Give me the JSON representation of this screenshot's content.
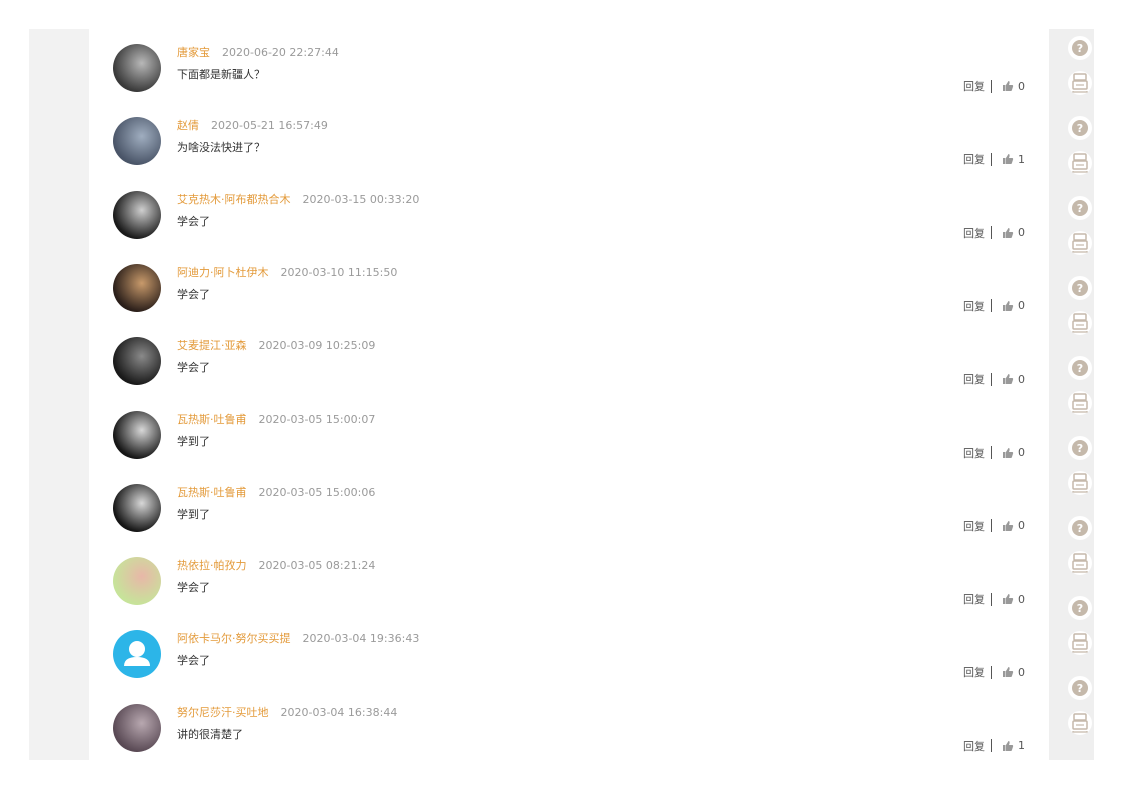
{
  "comments": [
    {
      "username": "唐家宝",
      "time": "2020-06-20 22:27:44",
      "text": "下面都是新疆人？",
      "reply": "回复",
      "likes": "0",
      "avatar_colors": [
        "#3a3a3a",
        "#b8b8b8"
      ]
    },
    {
      "username": "赵倩",
      "time": "2020-05-21 16:57:49",
      "text": "为啥没法快进了？",
      "reply": "回复",
      "likes": "1",
      "avatar_colors": [
        "#4a5568",
        "#a0aec0"
      ]
    },
    {
      "username": "艾克热木·阿布都热合木",
      "time": "2020-03-15 00:33:20",
      "text": "学会了",
      "reply": "回复",
      "likes": "0",
      "avatar_colors": [
        "#1a1a1a",
        "#cfcfcf"
      ]
    },
    {
      "username": "阿迪力·阿卜杜伊木",
      "time": "2020-03-10 11:15:50",
      "text": "学会了",
      "reply": "回复",
      "likes": "0",
      "avatar_colors": [
        "#2b1f1a",
        "#c89a6b"
      ]
    },
    {
      "username": "艾麦提江·亚森",
      "time": "2020-03-09 10:25:09",
      "text": "学会了",
      "reply": "回复",
      "likes": "0",
      "avatar_colors": [
        "#1a1a1a",
        "#8a8a8a"
      ]
    },
    {
      "username": "瓦热斯·吐鲁甫",
      "time": "2020-03-05 15:00:07",
      "text": "学到了",
      "reply": "回复",
      "likes": "0",
      "avatar_colors": [
        "#161616",
        "#d8d8d8"
      ]
    },
    {
      "username": "瓦热斯·吐鲁甫",
      "time": "2020-03-05 15:00:06",
      "text": "学到了",
      "reply": "回复",
      "likes": "0",
      "avatar_colors": [
        "#161616",
        "#d8d8d8"
      ]
    },
    {
      "username": "热依拉·帕孜力",
      "time": "2020-03-05 08:21:24",
      "text": "学会了",
      "reply": "回复",
      "likes": "0",
      "avatar_colors": [
        "#c7e39a",
        "#e8b7a8"
      ]
    },
    {
      "username": "阿依卡马尔·努尔买买提",
      "time": "2020-03-04 19:36:43",
      "text": "学会了",
      "reply": "回复",
      "likes": "0",
      "avatar_colors": [
        "#2cb5e8",
        "#ffffff"
      ]
    },
    {
      "username": "努尔尼莎汗·买吐地",
      "time": "2020-03-04 16:38:44",
      "text": "讲的很清楚了",
      "reply": "回复",
      "likes": "1",
      "avatar_colors": [
        "#5a4a55",
        "#b8a8b0"
      ]
    }
  ],
  "side_icons": [
    "help-icon",
    "shop-icon"
  ],
  "colors": {
    "username": "#e39a3a",
    "timestamp": "#9a9a9a",
    "icon": "#c5b9ab"
  }
}
